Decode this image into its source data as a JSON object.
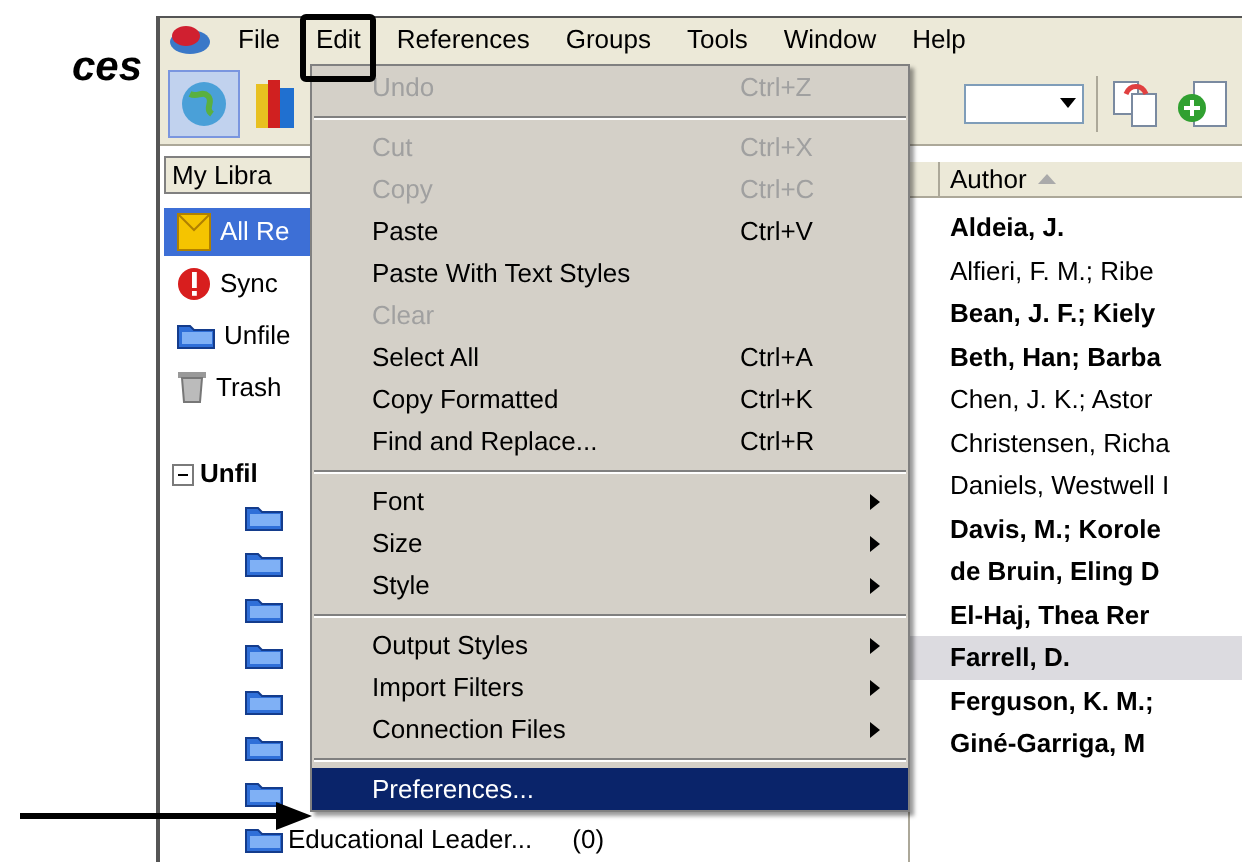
{
  "heading": "ces",
  "menu_bar": [
    {
      "label": "File",
      "selected": false
    },
    {
      "label": "Edit",
      "selected": true
    },
    {
      "label": "References",
      "selected": false
    },
    {
      "label": "Groups",
      "selected": false
    },
    {
      "label": "Tools",
      "selected": false
    },
    {
      "label": "Window",
      "selected": false
    },
    {
      "label": "Help",
      "selected": false
    }
  ],
  "edit_menu": [
    {
      "kind": "item",
      "label": "Undo",
      "shortcut": "Ctrl+Z",
      "disabled": true,
      "submenu": false,
      "selected": false
    },
    {
      "kind": "separator"
    },
    {
      "kind": "item",
      "label": "Cut",
      "shortcut": "Ctrl+X",
      "disabled": true,
      "submenu": false,
      "selected": false
    },
    {
      "kind": "item",
      "label": "Copy",
      "shortcut": "Ctrl+C",
      "disabled": true,
      "submenu": false,
      "selected": false
    },
    {
      "kind": "item",
      "label": "Paste",
      "shortcut": "Ctrl+V",
      "disabled": false,
      "submenu": false,
      "selected": false
    },
    {
      "kind": "item",
      "label": "Paste With Text Styles",
      "disabled": false,
      "submenu": false,
      "selected": false
    },
    {
      "kind": "item",
      "label": "Clear",
      "disabled": true,
      "submenu": false,
      "selected": false
    },
    {
      "kind": "item",
      "label": "Select All",
      "shortcut": "Ctrl+A",
      "disabled": false,
      "submenu": false,
      "selected": false
    },
    {
      "kind": "item",
      "label": "Copy Formatted",
      "shortcut": "Ctrl+K",
      "disabled": false,
      "submenu": false,
      "selected": false
    },
    {
      "kind": "item",
      "label": "Find and Replace...",
      "shortcut": "Ctrl+R",
      "disabled": false,
      "submenu": false,
      "selected": false
    },
    {
      "kind": "separator"
    },
    {
      "kind": "item",
      "label": "Font",
      "disabled": false,
      "submenu": true,
      "selected": false
    },
    {
      "kind": "item",
      "label": "Size",
      "disabled": false,
      "submenu": true,
      "selected": false
    },
    {
      "kind": "item",
      "label": "Style",
      "disabled": false,
      "submenu": true,
      "selected": false
    },
    {
      "kind": "separator"
    },
    {
      "kind": "item",
      "label": "Output Styles",
      "disabled": false,
      "submenu": true,
      "selected": false
    },
    {
      "kind": "item",
      "label": "Import Filters",
      "disabled": false,
      "submenu": true,
      "selected": false
    },
    {
      "kind": "item",
      "label": "Connection Files",
      "disabled": false,
      "submenu": true,
      "selected": false
    },
    {
      "kind": "separator"
    },
    {
      "kind": "item",
      "label": "Preferences...",
      "disabled": false,
      "submenu": false,
      "selected": true
    }
  ],
  "sidebar": {
    "header": "My Libra",
    "items": [
      {
        "kind": "all",
        "label": "All Re",
        "selected": true
      },
      {
        "kind": "sync",
        "label": "Sync",
        "selected": false
      },
      {
        "kind": "unfiled",
        "label": "Unfile",
        "selected": false
      },
      {
        "kind": "trash",
        "label": "Trash",
        "selected": false
      }
    ],
    "group": {
      "label": "Unfil",
      "expanded": true,
      "children": [
        {
          "kind": "folder"
        },
        {
          "kind": "folder"
        },
        {
          "kind": "folder"
        },
        {
          "kind": "folder"
        },
        {
          "kind": "folder"
        },
        {
          "kind": "folder"
        },
        {
          "kind": "folder"
        },
        {
          "kind": "folder",
          "label": "Educational Leader...",
          "count": "(0)"
        }
      ]
    }
  },
  "table": {
    "columns": [
      {
        "label": "Author",
        "sorted_ascending": true
      }
    ],
    "rows": [
      {
        "author": "Aldeia, J.",
        "unread": true,
        "selected": false
      },
      {
        "author": "Alfieri, F. M.; Ribe",
        "unread": false,
        "selected": false
      },
      {
        "author": "Bean, J. F.; Kiely",
        "unread": true,
        "selected": false
      },
      {
        "author": "Beth, Han; Barba",
        "unread": true,
        "selected": false
      },
      {
        "author": "Chen, J. K.; Astor",
        "unread": false,
        "selected": false
      },
      {
        "author": "Christensen, Richa",
        "unread": false,
        "selected": false
      },
      {
        "author": "Daniels, Westwell I",
        "unread": false,
        "selected": false
      },
      {
        "author": "Davis, M.; Korole",
        "unread": true,
        "selected": false
      },
      {
        "author": "de Bruin, Eling D",
        "unread": true,
        "selected": false
      },
      {
        "author": "El-Haj, Thea Rer",
        "unread": true,
        "selected": false
      },
      {
        "author": "Farrell, D.",
        "unread": true,
        "selected": true
      },
      {
        "author": "Ferguson, K. M.;",
        "unread": true,
        "selected": false
      },
      {
        "author": "Giné-Garriga, M",
        "unread": true,
        "selected": false
      }
    ]
  }
}
